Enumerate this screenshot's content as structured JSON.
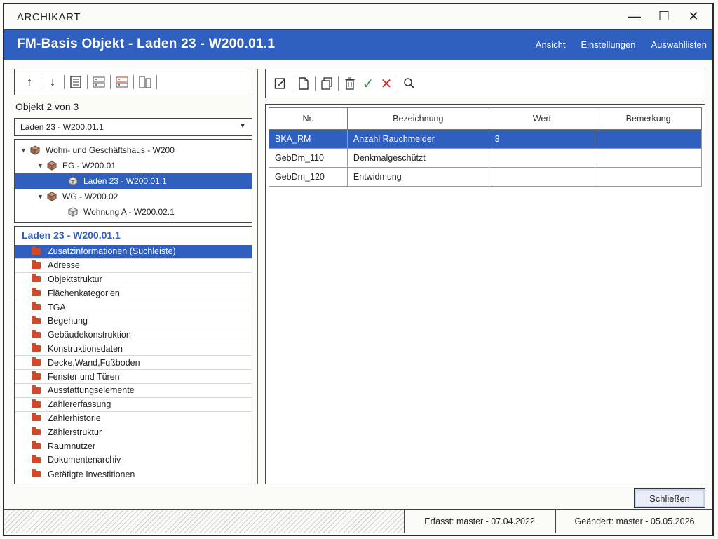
{
  "app": {
    "title": "ARCHIKART"
  },
  "window_controls": {
    "minimize": "—",
    "maximize": "☐",
    "close": "✕"
  },
  "header": {
    "title": "FM-Basis Objekt - Laden 23 - W200.01.1",
    "menu": [
      "Ansicht",
      "Einstellungen",
      "Auswahllisten"
    ]
  },
  "left_toolbar": {
    "icons": [
      "arrow-up-icon",
      "arrow-down-icon",
      "list-icon",
      "form-icon",
      "form-red-icon",
      "columns-icon"
    ]
  },
  "object_counter": "Objekt 2 von 3",
  "object_select": {
    "value": "Laden 23 - W200.01.1"
  },
  "tree": {
    "items": [
      {
        "label": "Wohn- und Geschäftshaus - W200",
        "icon": "building-cube-icon"
      },
      {
        "label": "EG - W200.01",
        "icon": "floor-cube-icon"
      },
      {
        "label": "Laden 23 - W200.01.1",
        "icon": "room-cube-icon",
        "selected": true
      },
      {
        "label": "WG - W200.02",
        "icon": "floor-cube-icon"
      },
      {
        "label": "Wohnung A - W200.02.1",
        "icon": "room-cube-icon"
      }
    ]
  },
  "sections": {
    "heading": "Laden 23 - W200.01.1",
    "items": [
      "Zusatzinformationen (Suchleiste)",
      "Adresse",
      "Objektstruktur",
      "Flächenkategorien",
      "TGA",
      "Begehung",
      "Gebäudekonstruktion",
      "Konstruktionsdaten",
      "Decke,Wand,Fußboden",
      "Fenster und Türen",
      "Ausstattungselemente",
      "Zählererfassung",
      "Zählerhistorie",
      "Zählerstruktur",
      "Raumnutzer",
      "Dokumentenarchiv",
      "Getätigte Investitionen"
    ],
    "selected": "Zusatzinformationen (Suchleiste)"
  },
  "right_toolbar": {
    "icons": [
      "edit-icon",
      "new-document-icon",
      "copy-icon",
      "delete-icon",
      "confirm-check-icon",
      "cancel-x-icon",
      "search-icon"
    ]
  },
  "table": {
    "columns": [
      "Nr.",
      "Bezeichnung",
      "Wert",
      "Bemerkung"
    ],
    "rows": [
      [
        "BKA_RM",
        "Anzahl Rauchmelder",
        "3",
        ""
      ],
      [
        "GebDm_110",
        "Denkmalgeschützt",
        "",
        ""
      ],
      [
        "GebDm_120",
        "Entwidmung",
        "",
        ""
      ]
    ]
  },
  "close_button": "Schließen",
  "status": {
    "created": "Erfasst: master - 07.04.2022",
    "changed": "Geändert: master - 05.05.2026"
  },
  "colors": {
    "accent": "#2f5fbf",
    "folder": "#cf4a2a",
    "check": "#2e8b3e",
    "cancel": "#c0392b"
  }
}
